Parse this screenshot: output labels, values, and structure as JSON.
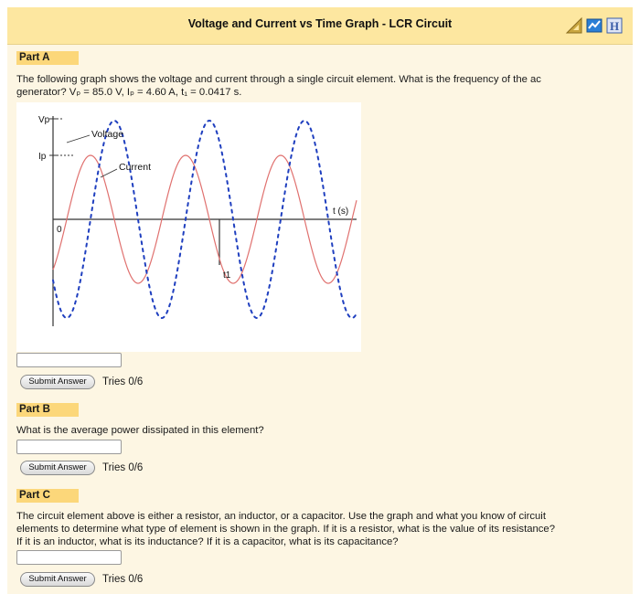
{
  "header": {
    "title": "Voltage and Current vs Time Graph - LCR Circuit",
    "icons": [
      "ruler-triangle-icon",
      "book-icon",
      "help-icon"
    ]
  },
  "part_a": {
    "label": "Part A",
    "question_line1": "The following graph shows the voltage and current through a single circuit element. What is the frequency of the ac",
    "question_line2": "generator? Vₚ = 85.0 V, Iₚ = 4.60 A, t₁ = 0.0417 s.",
    "answer_value": "",
    "submit_label": "Submit Answer",
    "tries": "Tries 0/6"
  },
  "graph": {
    "label_vp": "Vp",
    "label_ip": "Ip",
    "label_origin": "0",
    "label_voltage": "Voltage",
    "label_current": "Current",
    "label_t": "t (s)",
    "label_t1": "t1",
    "voltage_color": "#1f3fbf",
    "current_color": "#e0716f"
  },
  "part_b": {
    "label": "Part B",
    "question": "What is the average power dissipated in this element?",
    "answer_value": "",
    "submit_label": "Submit Answer",
    "tries": "Tries 0/6"
  },
  "part_c": {
    "label": "Part C",
    "question_line1": "The circuit element above is either a resistor, an inductor, or a capacitor. Use the graph and what you know of circuit",
    "question_line2": "elements to determine what type of element is shown in the graph. If it is a resistor, what is the value of its resistance?",
    "question_line3": "If it is an inductor, what is its inductance? If it is a capacitor, what is its capacitance?",
    "answer_value": "",
    "submit_label": "Submit Answer",
    "tries": "Tries 0/6"
  }
}
